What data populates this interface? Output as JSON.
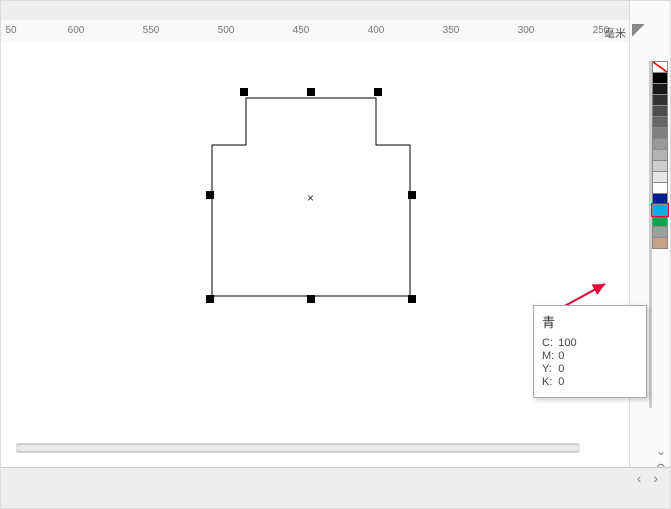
{
  "ruler": {
    "ticks": [
      "50",
      "600",
      "550",
      "500",
      "450",
      "400",
      "350",
      "300",
      "250"
    ],
    "unit": "毫米"
  },
  "palette": [
    {
      "id": "none",
      "hex": "#ffffff",
      "css": "none"
    },
    {
      "id": "black",
      "hex": "#000000"
    },
    {
      "id": "k90",
      "hex": "#1a1a1a"
    },
    {
      "id": "k80",
      "hex": "#333333"
    },
    {
      "id": "k70",
      "hex": "#4d4d4d"
    },
    {
      "id": "k60",
      "hex": "#666666"
    },
    {
      "id": "k50",
      "hex": "#808080"
    },
    {
      "id": "k40",
      "hex": "#999999"
    },
    {
      "id": "k30",
      "hex": "#b3b3b3"
    },
    {
      "id": "k20",
      "hex": "#cccccc"
    },
    {
      "id": "k10",
      "hex": "#e6e6e6"
    },
    {
      "id": "white",
      "hex": "#ffffff"
    },
    {
      "id": "blue",
      "hex": "#001c93"
    },
    {
      "id": "cyan",
      "hex": "#00aeef",
      "highlight": true
    },
    {
      "id": "green",
      "hex": "#00a651"
    },
    {
      "id": "gray",
      "hex": "#9e9e9e"
    },
    {
      "id": "brown",
      "hex": "#C4A484"
    }
  ],
  "tooltip": {
    "title": "青",
    "c_label": "C:",
    "c": "100",
    "m_label": "M:",
    "m": "0",
    "y_label": "Y:",
    "y": "0",
    "k_label": "K:",
    "k": "0"
  },
  "nav": {
    "prev": "‹",
    "next": "›",
    "zoom": "⚲",
    "chev": "⌄"
  },
  "center": "×"
}
